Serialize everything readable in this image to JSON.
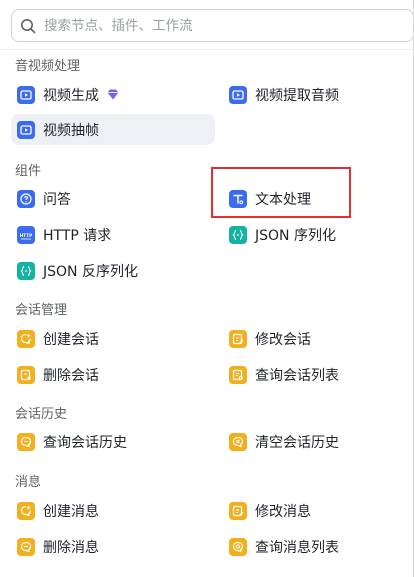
{
  "search": {
    "placeholder": "搜索节点、插件、工作流"
  },
  "sections": {
    "audio_video": "音视频处理",
    "components": "组件",
    "conversation_mgmt": "会话管理",
    "conversation_history": "会话历史",
    "message": "消息"
  },
  "items": {
    "video_generate": "视频生成",
    "video_extract_audio": "视频提取音频",
    "video_frame_extract": "视频抽帧",
    "qa": "问答",
    "text_processing": "文本处理",
    "http_request": "HTTP 请求",
    "json_serialize": "JSON 序列化",
    "json_deserialize": "JSON 反序列化",
    "create_conversation": "创建会话",
    "modify_conversation": "修改会话",
    "delete_conversation": "删除会话",
    "query_conversation_list": "查询会话列表",
    "query_conversation_history": "查询会话历史",
    "clear_conversation_history": "清空会话历史",
    "create_message": "创建消息",
    "modify_message": "修改消息",
    "delete_message": "删除消息",
    "query_message_list": "查询消息列表"
  },
  "icons": {
    "search": "search-icon",
    "premium": "diamond-icon",
    "video": "video-play-icon",
    "qa": "question-icon",
    "text": "text-process-icon",
    "http": "http-icon",
    "json": "json-braces-icon",
    "conversation": "chat-icon"
  },
  "colors": {
    "blue_icon": "#3b6cf0",
    "teal_icon": "#14b3a3",
    "orange_icon": "#f2b01e",
    "premium": "#7b5cf5",
    "highlight_border": "#e03030",
    "selected_bg": "#eef0f4"
  },
  "state": {
    "selected_item": "video_frame_extract",
    "highlighted_item": "text_processing"
  }
}
